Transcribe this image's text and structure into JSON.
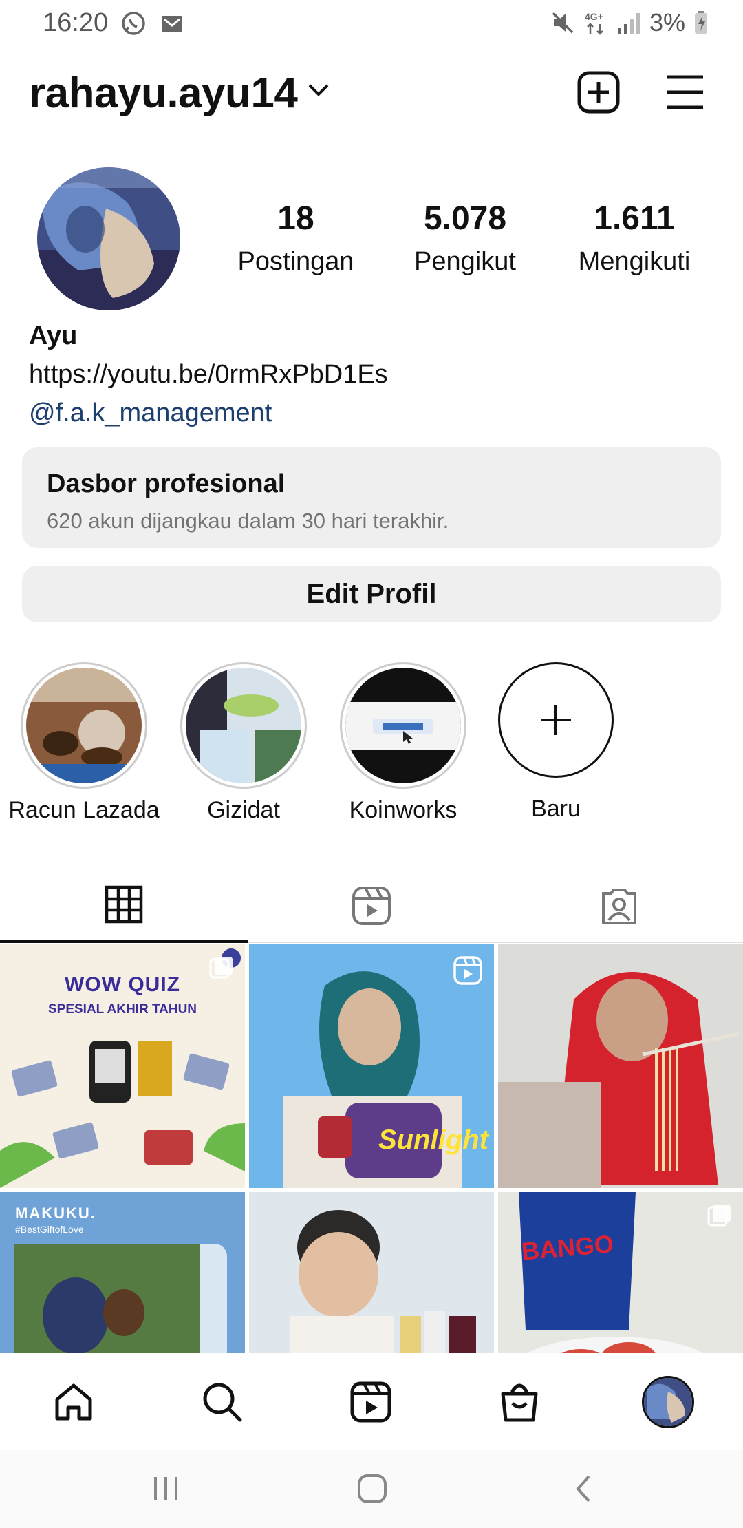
{
  "status": {
    "time": "16:20",
    "battery": "3%",
    "network": "4G+"
  },
  "header": {
    "username": "rahayu.ayu14"
  },
  "profile": {
    "stats": [
      {
        "value": "18",
        "label": "Postingan"
      },
      {
        "value": "5.078",
        "label": "Pengikut"
      },
      {
        "value": "1.611",
        "label": "Mengikuti"
      }
    ],
    "name": "Ayu",
    "link": "https://youtu.be/0rmRxPbD1Es",
    "mention": "@f.a.k_management"
  },
  "dashboard": {
    "title": "Dasbor profesional",
    "subtitle": "620 akun dijangkau dalam 30 hari terakhir."
  },
  "edit_profile_label": "Edit Profil",
  "highlights": [
    {
      "label": "Racun Lazada"
    },
    {
      "label": "Gizidat"
    },
    {
      "label": "Koinworks"
    },
    {
      "label": "Baru"
    }
  ],
  "grid_posts": [
    {
      "title": "WOW QUIZ",
      "subtitle": "SPESIAL AKHIR TAHUN",
      "type": "carousel"
    },
    {
      "text": "Sunlight",
      "type": "reel"
    },
    {
      "type": "image"
    },
    {
      "text": "MAKUKU.",
      "subtext": "#BestGiftofLove",
      "type": "image"
    },
    {
      "type": "image"
    },
    {
      "text": "BANGO",
      "type": "carousel"
    }
  ],
  "colors": {
    "accent_link": "#1d3f6e",
    "button_bg": "#efefef",
    "text": "#111111"
  }
}
